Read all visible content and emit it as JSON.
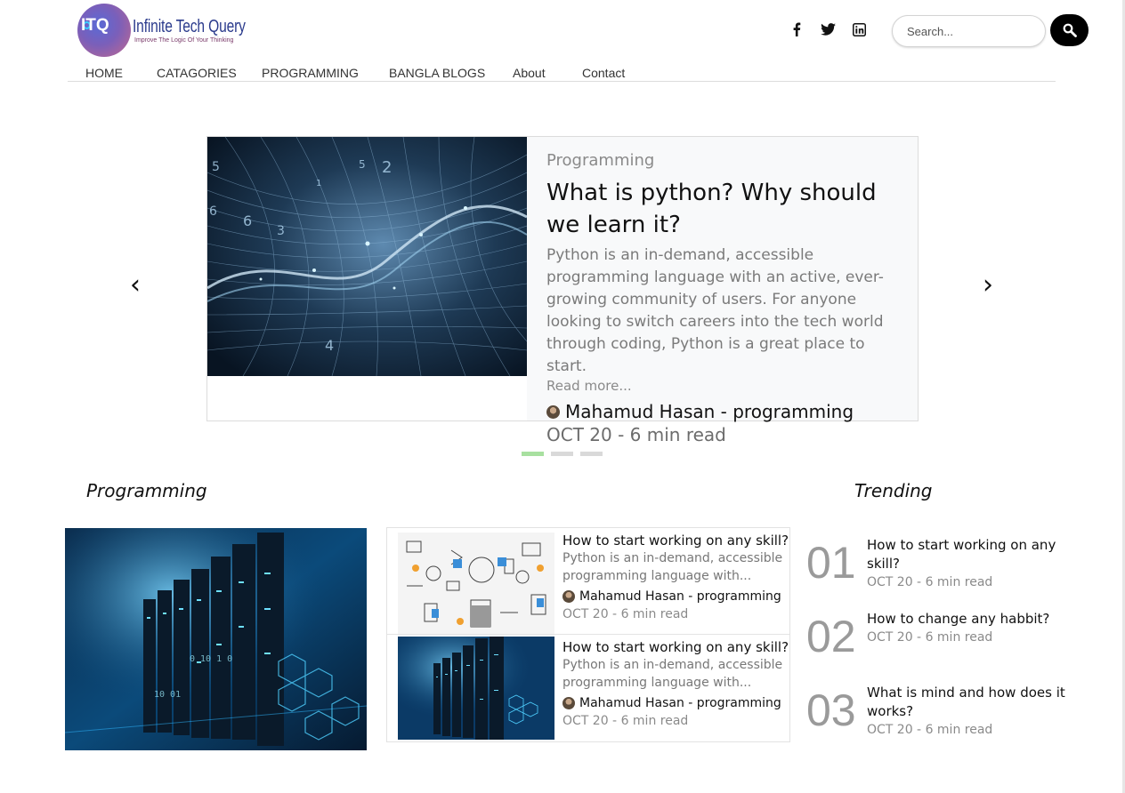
{
  "site": {
    "logo_initials": "ITQ",
    "logo_name": "Infinite Tech Query",
    "logo_tagline": "Improve The Logic Of Your Thinking"
  },
  "header": {
    "social_icons": [
      "facebook-icon",
      "twitter-icon",
      "linkedin-icon"
    ],
    "search_placeholder": "Search..."
  },
  "nav": {
    "items": [
      "HOME",
      "CATAGORIES",
      "PROGRAMMING",
      "BANGLA BLOGS",
      "About",
      "Contact"
    ]
  },
  "hero": {
    "category": "Programming",
    "title": "What is python? Why should we learn it?",
    "excerpt": "Python is an in-demand, accessible programming language with an active, ever-growing community of users. For anyone looking to switch careers into the tech world through coding, Python is a great place to start.",
    "read_more": "Read more...",
    "author": "Mahamud Hasan - programming",
    "date": "OCT 20 - 6 min read",
    "prev": "‹",
    "next": "›",
    "active_slide": 1,
    "slide_count": 3,
    "active_indicator_color": "#a8e0a0"
  },
  "sections": {
    "programming_title": "Programming",
    "trending_title": "Trending"
  },
  "posts": [
    {
      "title": "How to start working on any skill?",
      "excerpt": "Python is an in-demand, accessible programming language with...",
      "author": "Mahamud Hasan - programming",
      "date": "OCT 20 - 6 min read"
    },
    {
      "title": "How to start working on any skill?",
      "excerpt": "Python is an in-demand, accessible programming language with...",
      "author": "Mahamud Hasan - programming",
      "date": "OCT 20 - 6 min read"
    }
  ],
  "trending": [
    {
      "num": "01",
      "title": "How to start working on any skill?",
      "date": "OCT 20 - 6 min read"
    },
    {
      "num": "02",
      "title": "How to change any habbit?",
      "date": "OCT 20 - 6 min read"
    },
    {
      "num": "03",
      "title": "What is mind and how does it works?",
      "date": "OCT 20 - 6 min read"
    }
  ]
}
